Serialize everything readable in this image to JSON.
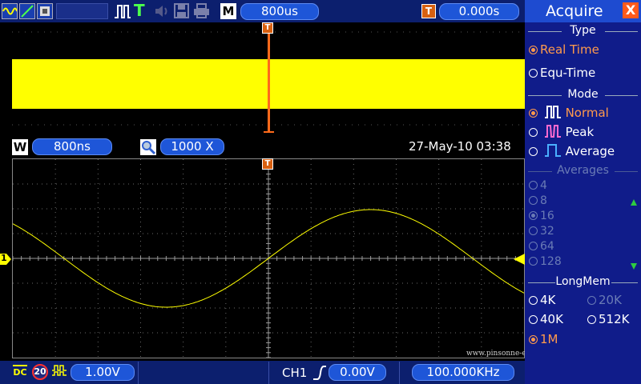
{
  "top_bar": {
    "timebase_badge": "M",
    "timebase_value": "800us",
    "trigger_badge": "T",
    "trigger_position": "0.000s",
    "icons": [
      "waveform-icon",
      "line-icon",
      "persistence-icon",
      "pulse-icon",
      "trigger-icon",
      "sound-icon",
      "save-icon",
      "print-icon"
    ]
  },
  "overview": {
    "trigger_marker": "T"
  },
  "window_bar": {
    "badge": "W",
    "window_timebase": "800ns",
    "zoom_factor": "1000 X",
    "datetime": "27-May-10 03:38"
  },
  "waveform": {
    "channel_marker": "1",
    "trigger_marker": "T"
  },
  "bottom_bar": {
    "coupling": "DC",
    "bw_limit": "20",
    "volts_per_div": "1.00V",
    "trigger_channel": "CH1",
    "trigger_level": "0.00V",
    "frequency": "100.000KHz"
  },
  "watermark": "www.pinsonne-elektronik.de",
  "menu": {
    "title": "Acquire",
    "close": "X",
    "sections": {
      "type": "Type",
      "mode": "Mode",
      "averages": "Averages",
      "longmem": "LongMem"
    },
    "type_options": [
      "Real Time",
      "Equ-Time"
    ],
    "mode_options": [
      "Normal",
      "Peak",
      "Average"
    ],
    "average_options": [
      "4",
      "8",
      "16",
      "32",
      "64",
      "128"
    ],
    "longmem_options": [
      "4K",
      "20K",
      "40K",
      "512K",
      "1M"
    ],
    "colors": {
      "active": "#ff9a4c",
      "disabled": "#6a7bb5",
      "panel": "#101c8a",
      "trace": "#ffff00"
    }
  }
}
